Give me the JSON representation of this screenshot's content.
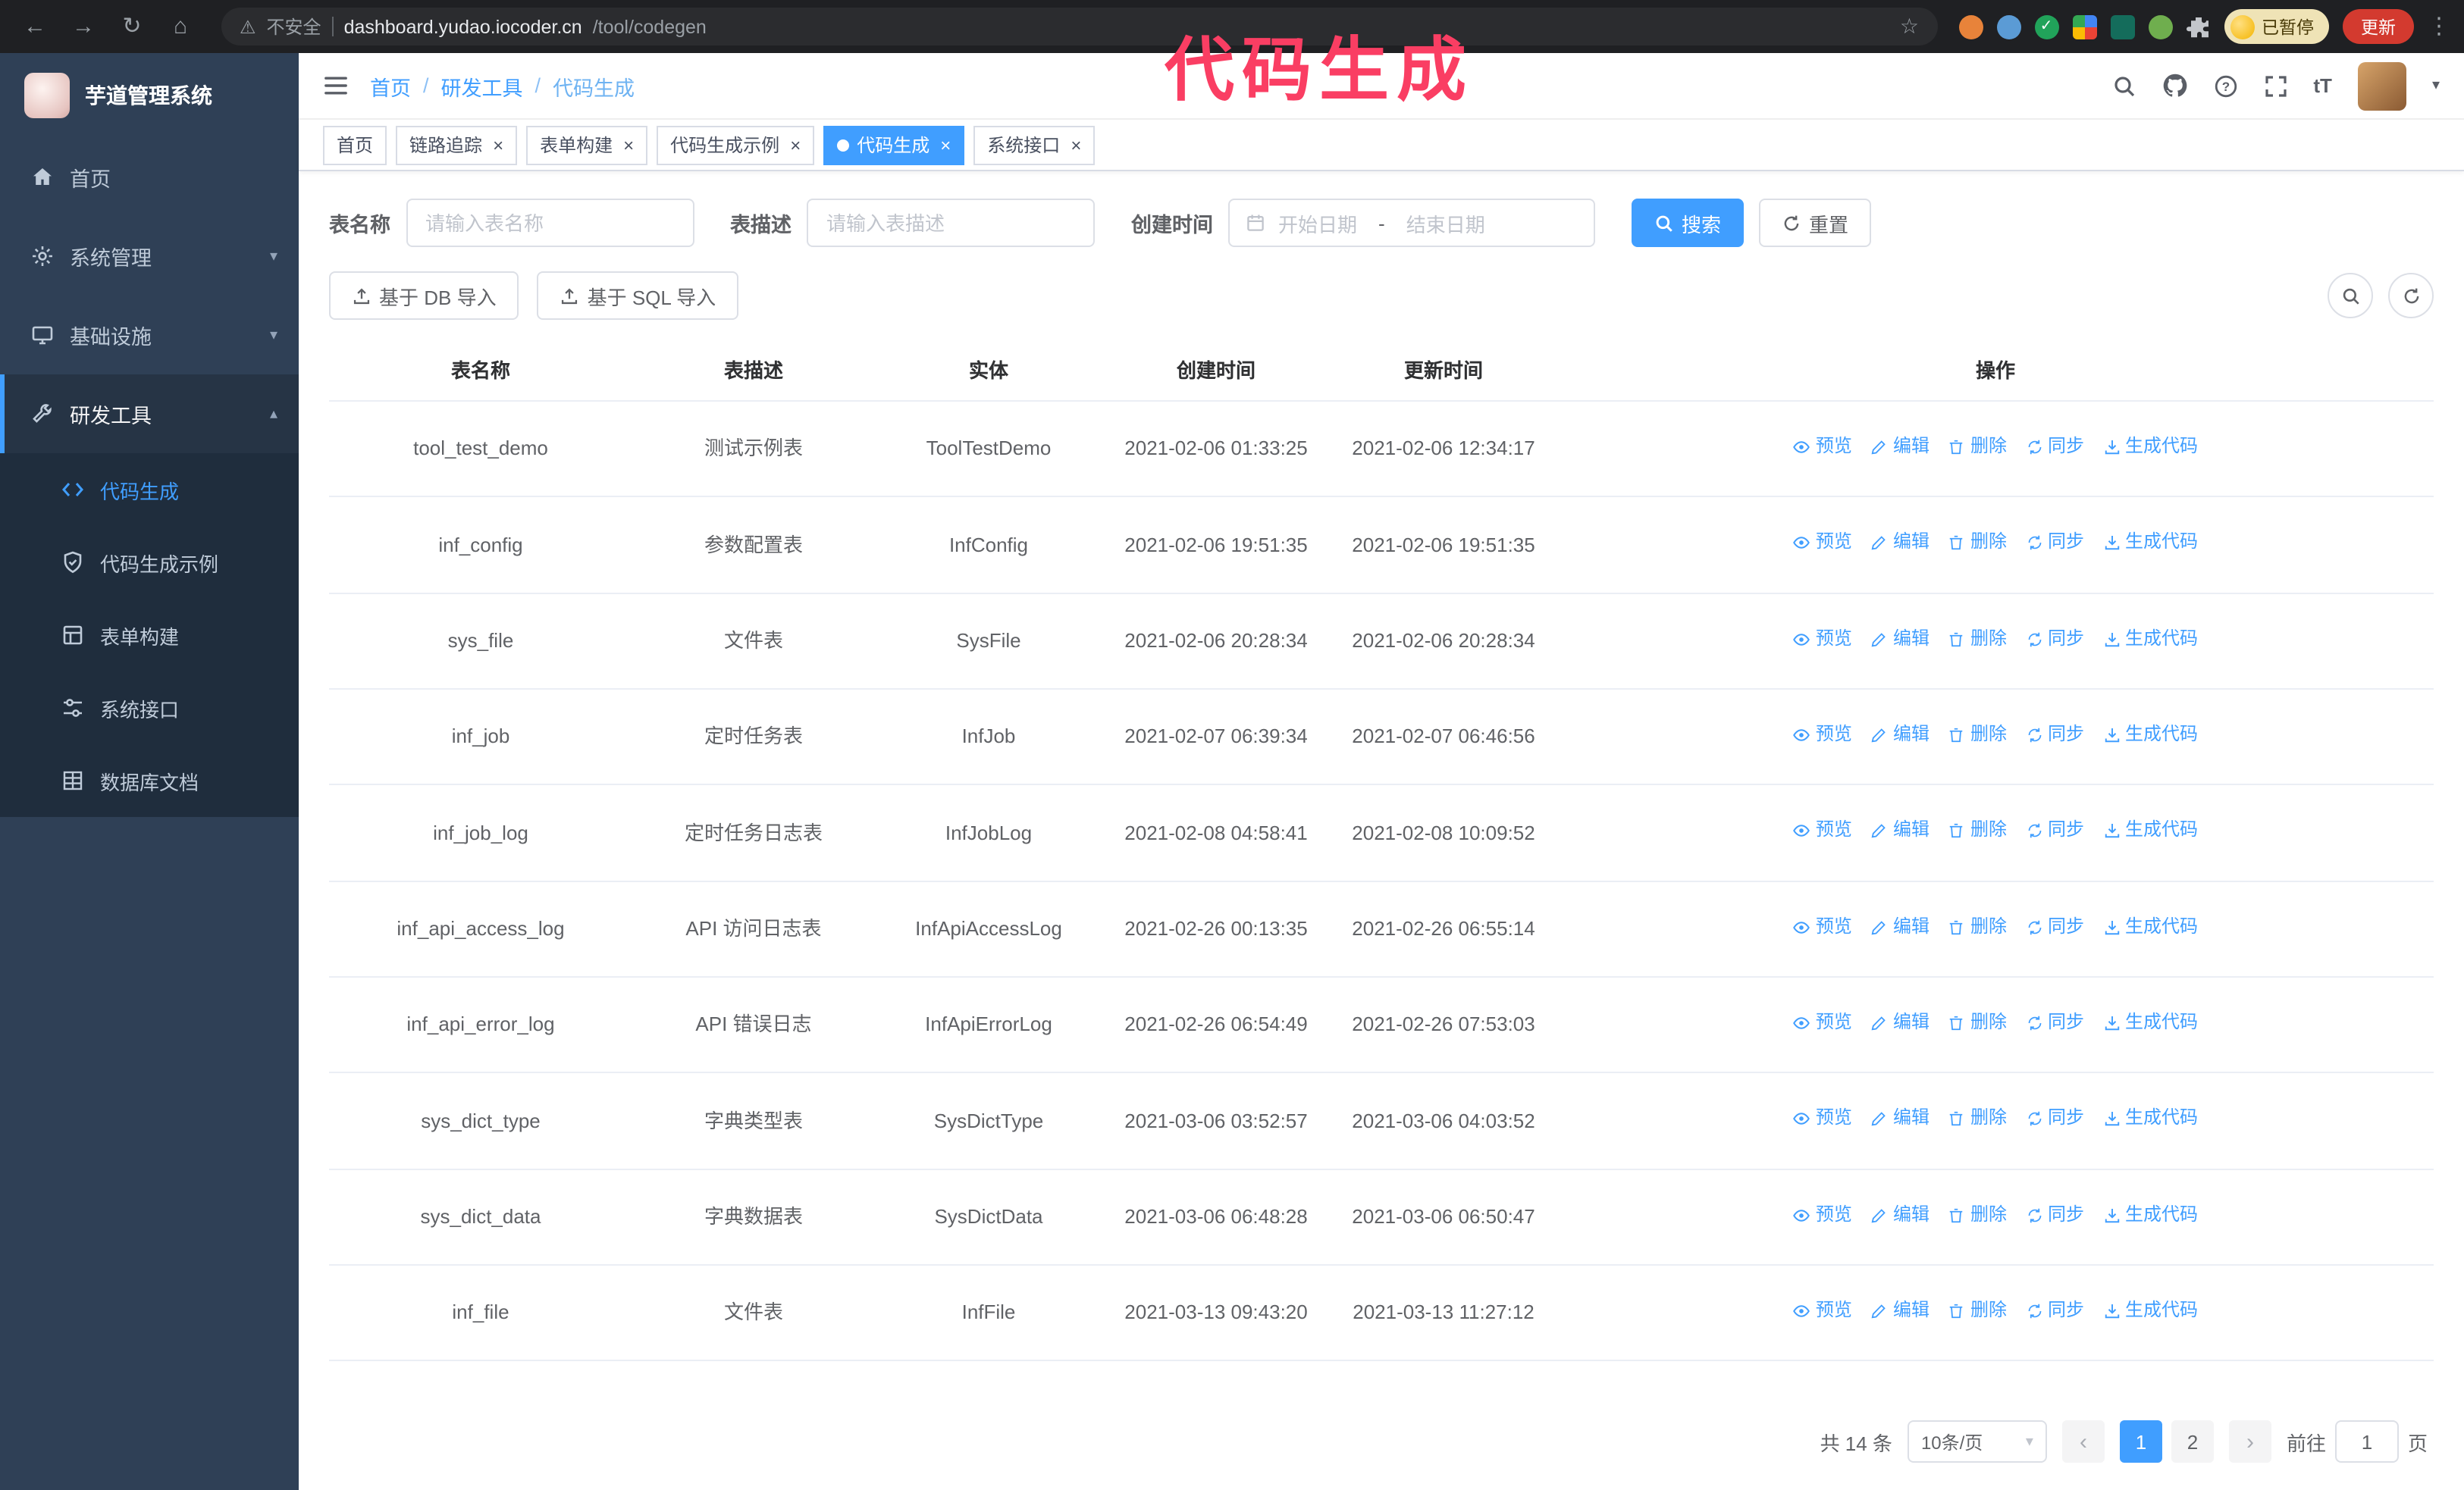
{
  "browser": {
    "security_label": "不安全",
    "url_host": "dashboard.yudao.iocoder.cn",
    "url_path": "/tool/codegen",
    "paused_badge": "已暂停",
    "update_button": "更新"
  },
  "icons": {
    "back": "←",
    "forward": "→",
    "reload": "↻",
    "home": "⌂",
    "warning": "⚠",
    "star": "☆",
    "menu_dots": "⋮",
    "caret_down": "▾",
    "chevron_down": "▾",
    "chevron_up": "▴",
    "font_size": "tT",
    "close": "×",
    "prev": "‹",
    "next": "›"
  },
  "annotation": {
    "text": "代码生成",
    "color": "#fa3e63"
  },
  "sidebar": {
    "logo_title": "芋道管理系统",
    "home": "首页",
    "system": "系统管理",
    "infra": "基础设施",
    "devtools": "研发工具",
    "sub": [
      "代码生成",
      "代码生成示例",
      "表单构建",
      "系统接口",
      "数据库文档"
    ]
  },
  "header": {
    "breadcrumb": [
      "首页",
      "研发工具",
      "代码生成"
    ],
    "breadcrumb_sep": "/"
  },
  "tabs": [
    {
      "label": "首页",
      "closable": false,
      "active": false
    },
    {
      "label": "链路追踪",
      "closable": true,
      "active": false
    },
    {
      "label": "表单构建",
      "closable": true,
      "active": false
    },
    {
      "label": "代码生成示例",
      "closable": true,
      "active": false
    },
    {
      "label": "代码生成",
      "closable": true,
      "active": true
    },
    {
      "label": "系统接口",
      "closable": true,
      "active": false
    }
  ],
  "search": {
    "name_label": "表名称",
    "name_placeholder": "请输入表名称",
    "desc_label": "表描述",
    "desc_placeholder": "请输入表描述",
    "time_label": "创建时间",
    "start_placeholder": "开始日期",
    "end_placeholder": "结束日期",
    "range_separator": "-",
    "search_button": "搜索",
    "reset_button": "重置"
  },
  "toolbar": {
    "import_db": "基于 DB 导入",
    "import_sql": "基于 SQL 导入"
  },
  "table": {
    "columns": [
      "表名称",
      "表描述",
      "实体",
      "创建时间",
      "更新时间",
      "操作"
    ],
    "op_labels": [
      "预览",
      "编辑",
      "删除",
      "同步",
      "生成代码"
    ],
    "rows": [
      {
        "name": "tool_test_demo",
        "desc": "测试示例表",
        "entity": "ToolTestDemo",
        "created": "2021-02-06 01:33:25",
        "updated": "2021-02-06 12:34:17"
      },
      {
        "name": "inf_config",
        "desc": "参数配置表",
        "entity": "InfConfig",
        "created": "2021-02-06 19:51:35",
        "updated": "2021-02-06 19:51:35"
      },
      {
        "name": "sys_file",
        "desc": "文件表",
        "entity": "SysFile",
        "created": "2021-02-06 20:28:34",
        "updated": "2021-02-06 20:28:34"
      },
      {
        "name": "inf_job",
        "desc": "定时任务表",
        "entity": "InfJob",
        "created": "2021-02-07 06:39:34",
        "updated": "2021-02-07 06:46:56"
      },
      {
        "name": "inf_job_log",
        "desc": "定时任务日志表",
        "entity": "InfJobLog",
        "created": "2021-02-08 04:58:41",
        "updated": "2021-02-08 10:09:52"
      },
      {
        "name": "inf_api_access_log",
        "desc": "API 访问日志表",
        "entity": "InfApiAccessLog",
        "created": "2021-02-26 00:13:35",
        "updated": "2021-02-26 06:55:14"
      },
      {
        "name": "inf_api_error_log",
        "desc": "API 错误日志",
        "entity": "InfApiErrorLog",
        "created": "2021-02-26 06:54:49",
        "updated": "2021-02-26 07:53:03"
      },
      {
        "name": "sys_dict_type",
        "desc": "字典类型表",
        "entity": "SysDictType",
        "created": "2021-03-06 03:52:57",
        "updated": "2021-03-06 04:03:52"
      },
      {
        "name": "sys_dict_data",
        "desc": "字典数据表",
        "entity": "SysDictData",
        "created": "2021-03-06 06:48:28",
        "updated": "2021-03-06 06:50:47"
      },
      {
        "name": "inf_file",
        "desc": "文件表",
        "entity": "InfFile",
        "created": "2021-03-13 09:43:20",
        "updated": "2021-03-13 11:27:12"
      }
    ]
  },
  "pagination": {
    "total": "共 14 条",
    "page_size": "10条/页",
    "pages": [
      "1",
      "2"
    ],
    "active_page": "1",
    "goto_label": "前往",
    "goto_value": "1",
    "page_suffix": "页"
  }
}
